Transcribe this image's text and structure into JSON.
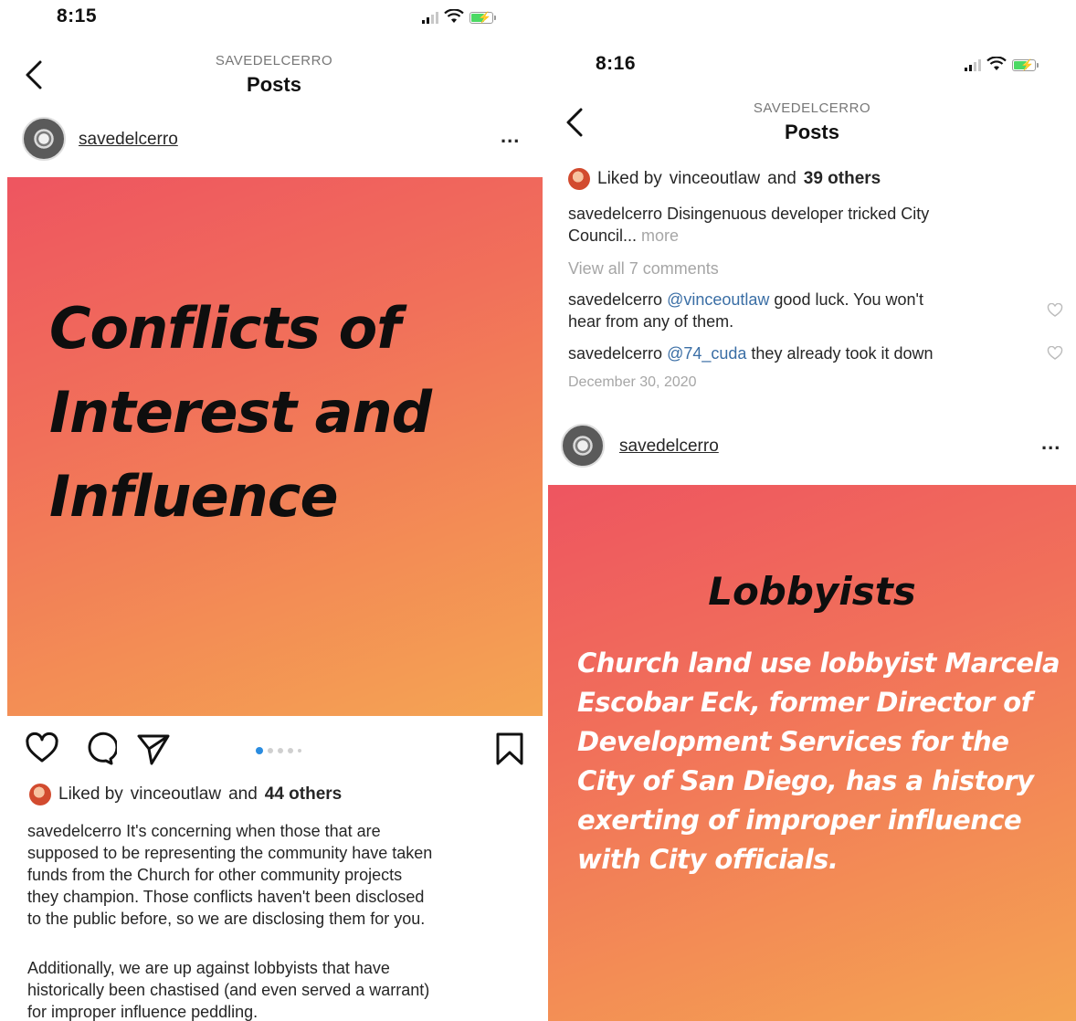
{
  "left": {
    "status_time": "8:15",
    "nav": {
      "account": "SAVEDELCERRO",
      "title": "Posts"
    },
    "post": {
      "username": "savedelcerro",
      "more": "...",
      "image_title_lines": [
        "Conflicts of",
        "Interest and",
        "Influence"
      ],
      "likes": {
        "prefix": "Liked by",
        "liker": "vinceoutlaw",
        "and": "and",
        "others": "44 others"
      },
      "caption": {
        "username": "savedelcerro",
        "para1_lines": [
          " It's concerning when those that are",
          "supposed to be representing the community have taken",
          "funds from the Church for other community projects",
          "they champion. Those conflicts haven't been disclosed",
          "to the public before, so we are disclosing them for you."
        ],
        "para2_lines": [
          "Additionally, we are up against lobbyists that have",
          "historically been chastised (and even served a warrant)",
          "for improper influence peddling."
        ]
      },
      "carousel": {
        "count": 5,
        "active": 1
      }
    }
  },
  "right": {
    "status_time": "8:16",
    "nav": {
      "account": "SAVEDELCERRO",
      "title": "Posts"
    },
    "prev_post": {
      "likes": {
        "prefix": "Liked by",
        "liker": "vinceoutlaw",
        "and": "and",
        "others": "39 others"
      },
      "caption_user": "savedelcerro",
      "caption_line1": " Disingenuous developer tricked City",
      "caption_line2": "Council...",
      "more": " more",
      "view_comments": "View all 7 comments",
      "comments": [
        {
          "user": "savedelcerro",
          "mention": "@vinceoutlaw",
          "text_line1": " good luck. You won't",
          "text_line2": "hear from any of them."
        },
        {
          "user": "savedelcerro",
          "mention": "@74_cuda",
          "text_line1": " they already took it down",
          "text_line2": ""
        }
      ],
      "date": "December 30, 2020"
    },
    "post": {
      "username": "savedelcerro",
      "more": "...",
      "image_title": "Lobbyists",
      "image_body_lines": [
        "Church land use lobbyist Marcela",
        "Escobar Eck, former Director of",
        "Development Services for the",
        "City of San Diego, has a history",
        "exerting of improper influence",
        "with City officials."
      ]
    }
  }
}
